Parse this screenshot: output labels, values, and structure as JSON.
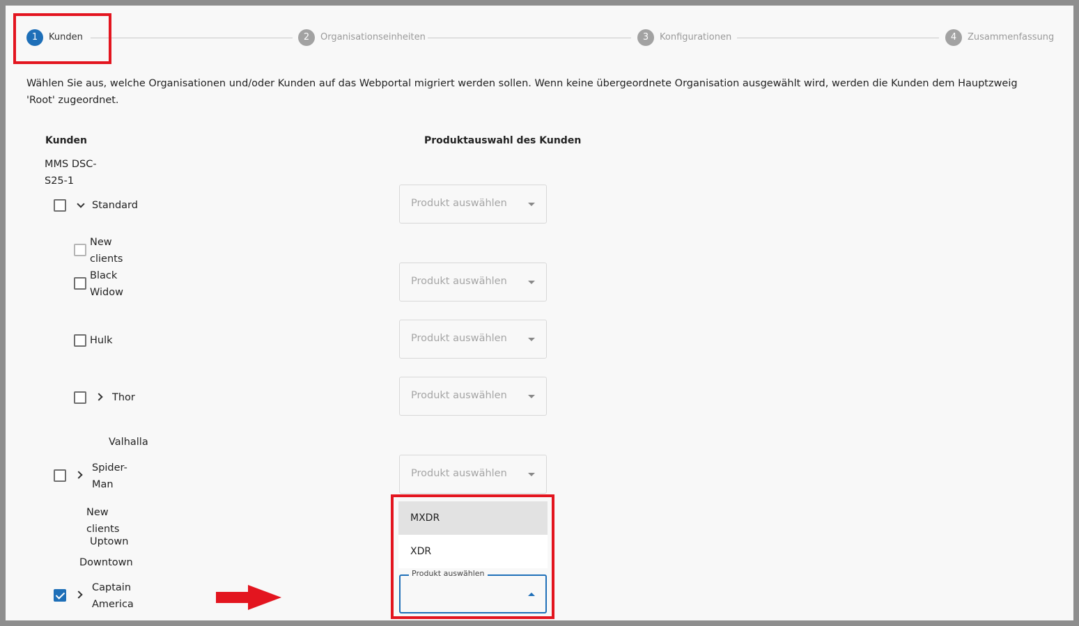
{
  "stepper": {
    "steps": [
      {
        "number": "1",
        "label": "Kunden"
      },
      {
        "number": "2",
        "label": "Organisationseinheiten"
      },
      {
        "number": "3",
        "label": "Konfigurationen"
      },
      {
        "number": "4",
        "label": "Zusammenfassung"
      }
    ]
  },
  "description": "Wählen Sie aus, welche Organisationen und/oder Kunden auf das Webportal migriert werden sollen. Wenn keine übergeordnete Organisation ausgewählt wird, werden die Kunden dem Hauptzweig 'Root' zugeordnet.",
  "headers": {
    "customers": "Kunden",
    "product_selection": "Produktauswahl des Kunden"
  },
  "tree": {
    "root": [
      "MMS DSC-",
      "S25-1"
    ],
    "standard": "Standard",
    "new_clients_1": [
      "New",
      "clients"
    ],
    "black_widow": [
      "Black",
      "Widow"
    ],
    "hulk": "Hulk",
    "thor": "Thor",
    "valhalla": "Valhalla",
    "spider_man": [
      "Spider-",
      "Man"
    ],
    "new_clients_2": [
      "New",
      "clients"
    ],
    "uptown": "Uptown",
    "downtown": "Downtown",
    "captain_america": [
      "Captain",
      "America"
    ]
  },
  "product_select": {
    "placeholder": "Produkt auswählen",
    "floating_label": "Produkt auswählen",
    "options": [
      "MXDR",
      "XDR"
    ],
    "selected_option": ""
  },
  "colors": {
    "accent": "#1e6fb8",
    "highlight": "#e3151f"
  }
}
